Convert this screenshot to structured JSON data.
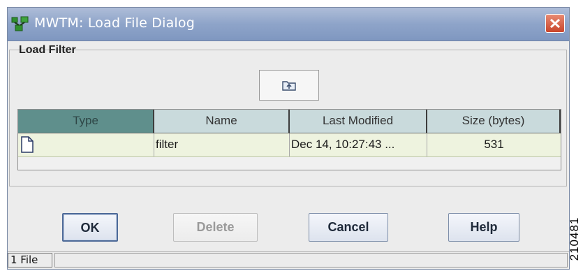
{
  "window": {
    "title": "MWTM: Load File Dialog",
    "icons": {
      "app": "network-app-icon",
      "close": "close-icon"
    }
  },
  "group": {
    "title": "Load Filter"
  },
  "toolbar": {
    "up_icon": "up-folder-icon"
  },
  "table": {
    "columns": [
      "Type",
      "Name",
      "Last Modified",
      "Size (bytes)"
    ],
    "rows": [
      {
        "type_icon": "document-icon",
        "name": "filter",
        "modified": "Dec 14, 10:27:43 ...",
        "size": "531"
      }
    ]
  },
  "buttons": {
    "ok": "OK",
    "delete": "Delete",
    "cancel": "Cancel",
    "help": "Help"
  },
  "status": {
    "text": "1 File"
  },
  "figure_id": "210481",
  "colors": {
    "titlebar": "#8ea4c9",
    "close": "#c9452b",
    "header_active": "#5f8f8c",
    "header": "#c9dadc"
  }
}
